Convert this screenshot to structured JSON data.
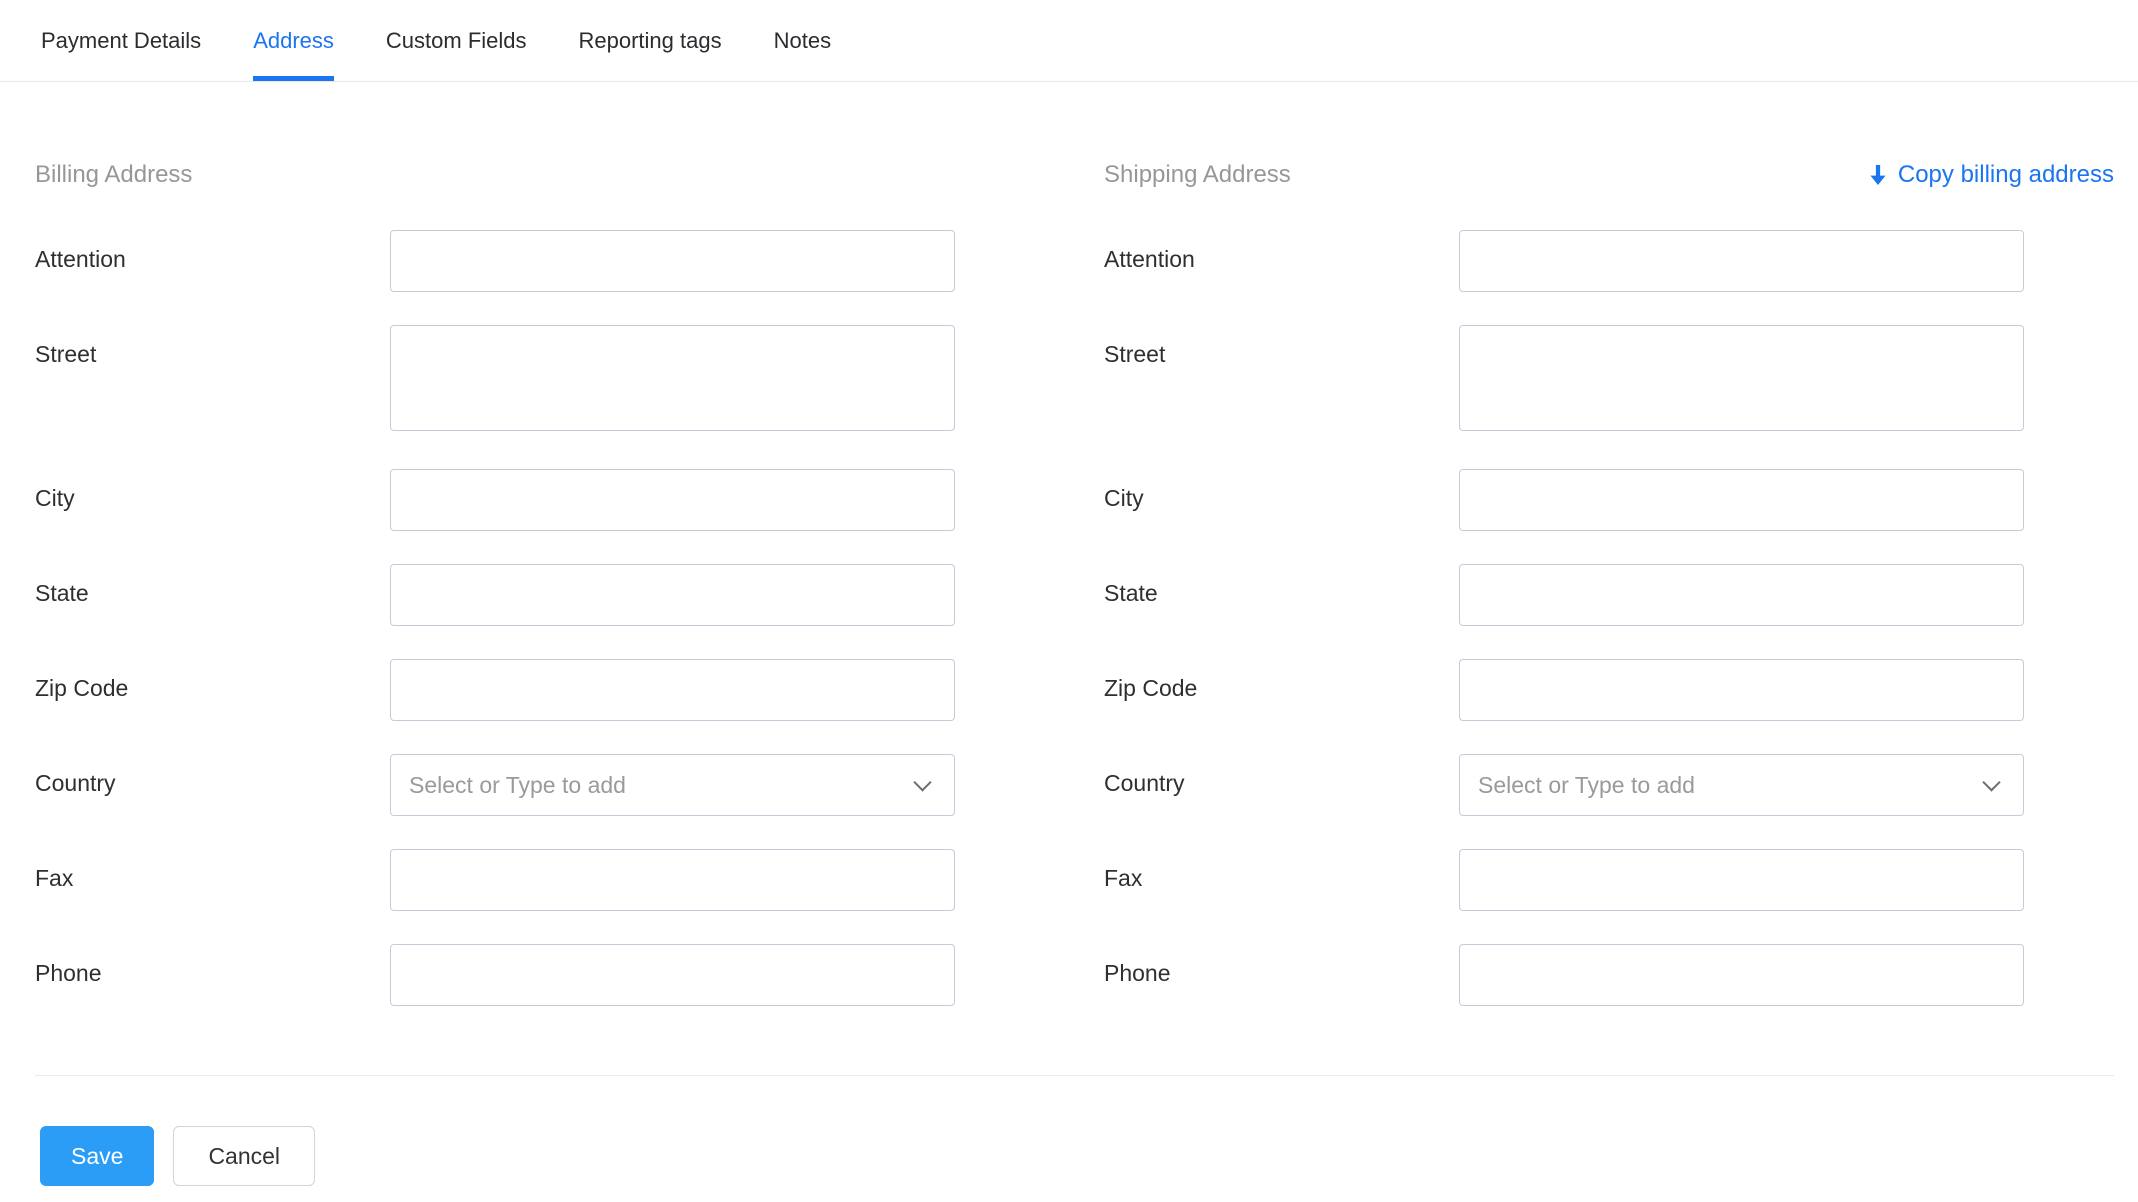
{
  "tabs": {
    "items": [
      {
        "label": "Payment Details"
      },
      {
        "label": "Address"
      },
      {
        "label": "Custom Fields"
      },
      {
        "label": "Reporting tags"
      },
      {
        "label": "Notes"
      }
    ],
    "active_index": 1
  },
  "addresses": {
    "billing_heading": "Billing Address",
    "shipping_heading": "Shipping Address",
    "copy_billing_label": "Copy billing address",
    "country_placeholder": "Select or Type to add",
    "labels": {
      "attention": "Attention",
      "street": "Street",
      "city": "City",
      "state": "State",
      "zip": "Zip Code",
      "country": "Country",
      "fax": "Fax",
      "phone": "Phone"
    },
    "values": {
      "billing": {
        "attention": "",
        "street": "",
        "city": "",
        "state": "",
        "zip": "",
        "country": "",
        "fax": "",
        "phone": ""
      },
      "shipping": {
        "attention": "",
        "street": "",
        "city": "",
        "state": "",
        "zip": "",
        "country": "",
        "fax": "",
        "phone": ""
      }
    }
  },
  "footer": {
    "save_label": "Save",
    "cancel_label": "Cancel"
  },
  "colors": {
    "accent": "#1b74f0",
    "save_bg": "#2b9df6",
    "input_border": "#c3ccd9",
    "heading_gray": "#97979b"
  }
}
